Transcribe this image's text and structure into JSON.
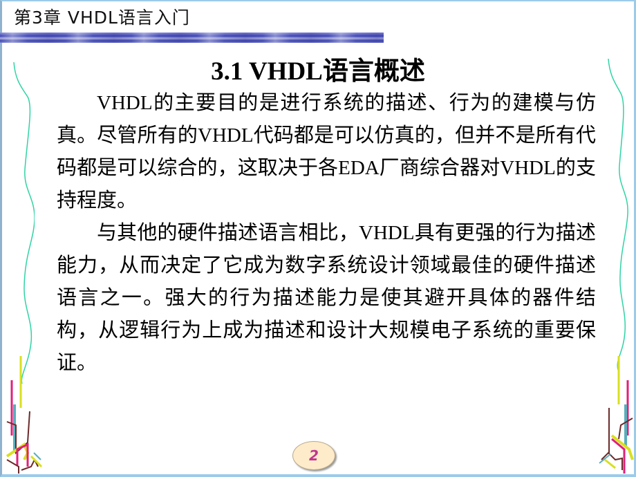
{
  "header": {
    "chapter_title": "第3章  VHDL语言入门"
  },
  "slide": {
    "title": "3.1  VHDL语言概述",
    "paragraphs": [
      "VHDL的主要目的是进行系统的描述、行为的建模与仿真。尽管所有的VHDL代码都是可以仿真的，但并不是所有代码都是可以综合的，这取决于各EDA厂商综合器对VHDL的支持程度。",
      "与其他的硬件描述语言相比，VHDL具有更强的行为描述能力，从而决定了它成为数字系统设计领域最佳的硬件描述语言之一。强大的行为描述能力是使其避开具体的器件结构，从逻辑行为上成为描述和设计大规模电子系统的重要保证。"
    ],
    "page_number": "2"
  },
  "colors": {
    "header_bar": "#3d44b3",
    "wavy_line": "#2fd3a3",
    "deco_yellow": "#d8e020",
    "deco_magenta": "#e0207a",
    "deco_teal": "#5aaebd",
    "deco_brown": "#6b2a2a",
    "page_badge": "#fdebc9",
    "page_number": "#c0368f",
    "frame": "#9ccbea"
  }
}
